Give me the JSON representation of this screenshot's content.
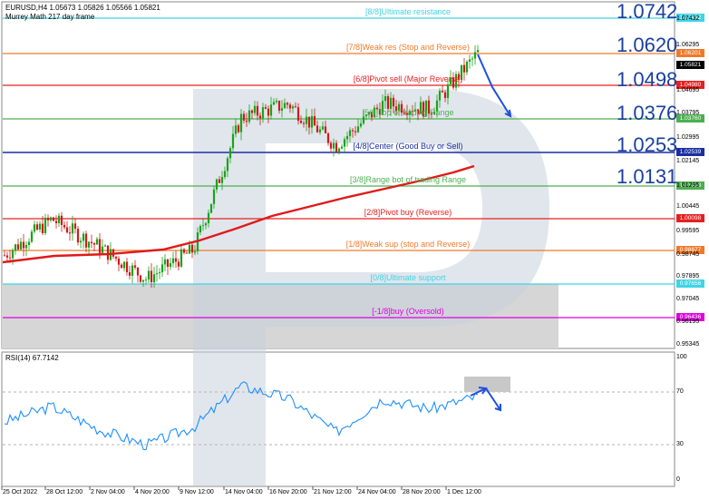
{
  "header": {
    "symbol_line": "EURUSD,H4  1.05673 1.05826 1.05566 1.05821",
    "indicator_name": "Murrey Math 217 day frame"
  },
  "big_levels": [
    "1.0742",
    "1.0620",
    "1.0498",
    "1.0376",
    "1.0253",
    "1.0131"
  ],
  "murrey_lines": [
    {
      "label": "[8/8]Ultimate resistance",
      "value": 1.07432,
      "tag": "1.07432",
      "color": "#3fd4e6"
    },
    {
      "label": "[7/8]Weak res (Stop and Reverse)",
      "value": 1.06201,
      "tag": "1.06201",
      "color": "#f07a2a"
    },
    {
      "label": "[6/8]Pivot sell (Major Reverse)",
      "value": 1.0498,
      "tag": "1.04980",
      "color": "#e62020"
    },
    {
      "label": "[5/8]Top of trading Range",
      "value": 1.0376,
      "tag": "1.03760",
      "color": "#4caf50"
    },
    {
      "label": "[4/8]Center (Good Buy or Sell)",
      "value": 1.02539,
      "tag": "1.02539",
      "color": "#1a2fa0"
    },
    {
      "label": "[3/8]Range bot of trading Range",
      "value": 1.01318,
      "tag": "1.01318",
      "color": "#4caf50"
    },
    {
      "label": "[2/8]Pivot buy (Reverse)",
      "value": 1.00098,
      "tag": "1.00098",
      "color": "#e62020"
    },
    {
      "label": "[1/8]Weak sup (stop and Reverse)",
      "value": 0.98877,
      "tag": "0.98877",
      "color": "#f07a2a"
    },
    {
      "label": "[0/8]Ultimate support",
      "value": 0.97656,
      "tag": "0.97656",
      "color": "#3fd4e6"
    },
    {
      "label": "[-1/8]buy (Oversold)",
      "value": 0.96436,
      "tag": "0.96436",
      "color": "#e000e0"
    }
  ],
  "price_axis_labels": [
    "1.07432",
    "1.06295",
    "1.05595",
    "1.04695",
    "1.03795",
    "1.02995",
    "1.02145",
    "1.01295",
    "1.00445",
    "0.99595",
    "0.98745",
    "0.97895",
    "0.97045",
    "0.96195",
    "0.95345"
  ],
  "current_price_tag": "1.05821",
  "rsi": {
    "label": "RSI(14) 67.7142",
    "axis_labels": [
      "100",
      "70",
      "30",
      "0"
    ],
    "levels": [
      70,
      30
    ]
  },
  "chart_data": {
    "type": "line",
    "title": "",
    "x": [
      "25 Oct 2022",
      "28 Oct 12:00",
      "2 Nov 04:00",
      "4 Nov 20:00",
      "9 Nov 12:00",
      "14 Nov 04:00",
      "16 Nov 20:00",
      "21 Nov 12:00",
      "24 Nov 04:00",
      "28 Nov 20:00",
      "1 Dec 12:00"
    ],
    "series": [
      {
        "name": "EURUSD",
        "values": [
          0.9855,
          0.9985,
          0.9885,
          0.977,
          0.9875,
          1.035,
          1.04,
          1.025,
          1.04,
          1.038,
          1.0582
        ]
      },
      {
        "name": "RSI(14)",
        "values": [
          48,
          60,
          42,
          30,
          44,
          76,
          66,
          40,
          66,
          58,
          67.7
        ]
      }
    ],
    "price_range": [
      0.952,
      1.076
    ],
    "rsi_range": [
      0,
      100
    ],
    "forecast": "up then down",
    "grid": false
  }
}
